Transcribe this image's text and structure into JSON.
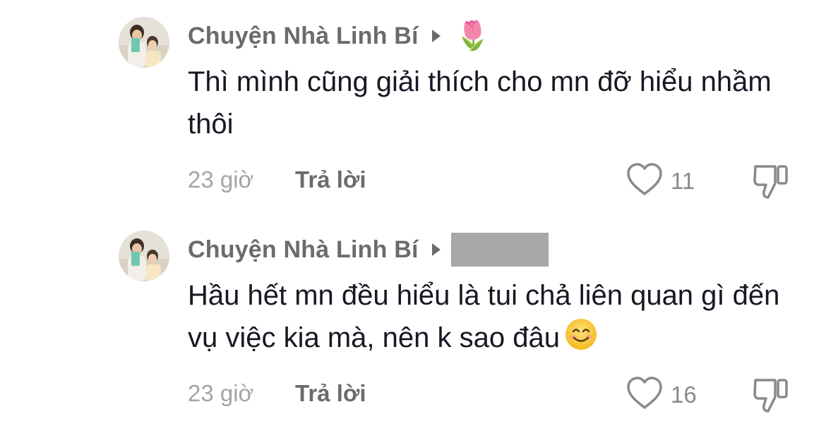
{
  "comments": [
    {
      "author": "Chuyện Nhà Linh Bí",
      "reply_target_emoji": "🌷",
      "text": "Thì mình cũng giải thích cho mn đỡ hiểu nhầm thôi",
      "time": "23 giờ",
      "reply_label": "Trả lời",
      "likes": "11",
      "icons": {
        "like": "heart-outline-icon",
        "dislike": "thumbs-down-outline-icon",
        "reply_arrow": "play-triangle-icon"
      }
    },
    {
      "author": "Chuyện Nhà Linh Bí",
      "reply_target_redacted": true,
      "text": "Hầu hết mn đều hiểu là tui chả liên quan gì đến vụ việc kia mà, nên k sao đâu",
      "time": "23 giờ",
      "reply_label": "Trả lời",
      "likes": "16",
      "icons": {
        "like": "heart-outline-icon",
        "dislike": "thumbs-down-outline-icon",
        "reply_arrow": "play-triangle-icon",
        "emoji": "smiling-face-emoji"
      }
    }
  ],
  "colors": {
    "author": "#6b6b6b",
    "text": "#161823",
    "meta": "#a4a4a4",
    "redacted": "#a8a8a8"
  }
}
